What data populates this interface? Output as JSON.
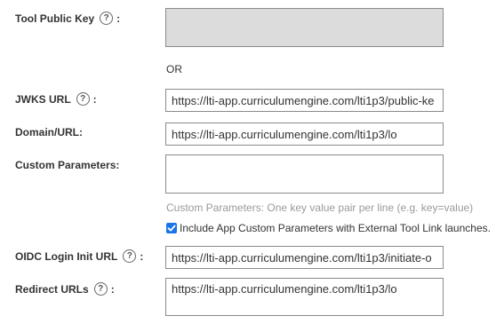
{
  "tool_public_key": {
    "label": "Tool Public Key",
    "value": ""
  },
  "or_separator": "OR",
  "jwks_url": {
    "label": "JWKS URL",
    "value": "https://lti-app.curriculumengine.com/lti1p3/public-ke"
  },
  "domain_url": {
    "label": "Domain/URL:",
    "value": "https://lti-app.curriculumengine.com/lti1p3/lo"
  },
  "custom_parameters": {
    "label": "Custom Parameters:",
    "value": "",
    "hint": "Custom Parameters: One key value pair per line (e.g. key=value)"
  },
  "include_custom_params": {
    "label": "Include App Custom Parameters with External Tool Link launches.",
    "checked": true
  },
  "oidc_login_init_url": {
    "label": "OIDC Login Init URL",
    "value": "https://lti-app.curriculumengine.com/lti1p3/initiate-o"
  },
  "redirect_urls": {
    "label": "Redirect URLs",
    "value": "https://lti-app.curriculumengine.com/lti1p3/lo"
  },
  "help_glyph": "?",
  "colon": ":",
  "colors": {
    "accent": "#1a73e8",
    "disabled_bg": "#dcdcdc",
    "hint_text": "#9a9a9a",
    "border": "#8a8a8a"
  }
}
